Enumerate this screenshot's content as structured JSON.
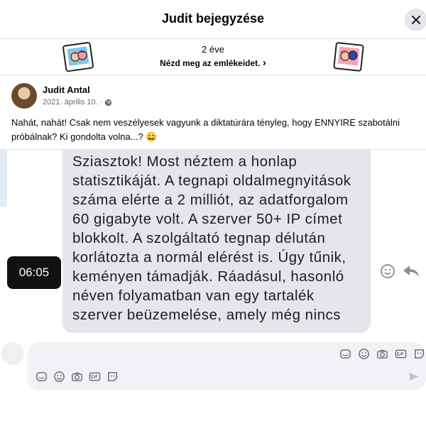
{
  "header": {
    "title": "Judit bejegyzése",
    "close_label": "×"
  },
  "memories": {
    "ago": "2 éve",
    "see_memories": "Nézd meg az emlékeidet.",
    "chevron": "›"
  },
  "post": {
    "author": "Judit Antal",
    "date": "2021. április 10. ·",
    "text": "Nahát, nahát! Csak nem veszélyesek vagyunk a diktatúrára tényleg, hogy ENNYIRE szabotálni próbálnak? Ki gondolta volna...? 😀"
  },
  "media": {
    "message_text": "Sziasztok! Most néztem a honlap statisztikáját. A tegnapi oldalmegnyitások száma elérte a 2 milliót, az adatforgalom 60 gigabyte volt. A szerver 50+ IP címet blokkolt. A szolgáltató tegnap délután korlátozta a normál elérést is. Úgy tűnik, keményen támadják. Ráadásul, hasonló néven folyamatban van egy tartalék szerver beüzemelése, amely még nincs",
    "timestamp": "06:05"
  },
  "icons": [
    "sticker-icon",
    "emoji-icon",
    "camera-icon",
    "gif-icon",
    "avatar-sticker-icon",
    "send-icon",
    "privacy-globe-icon",
    "react-smiley-icon",
    "reply-arrow-icon"
  ],
  "colors": {
    "bubble": "#e4e6eb",
    "composer": "#f0f2f5",
    "timestamp_bg": "#111111",
    "meta": "#65676b"
  }
}
